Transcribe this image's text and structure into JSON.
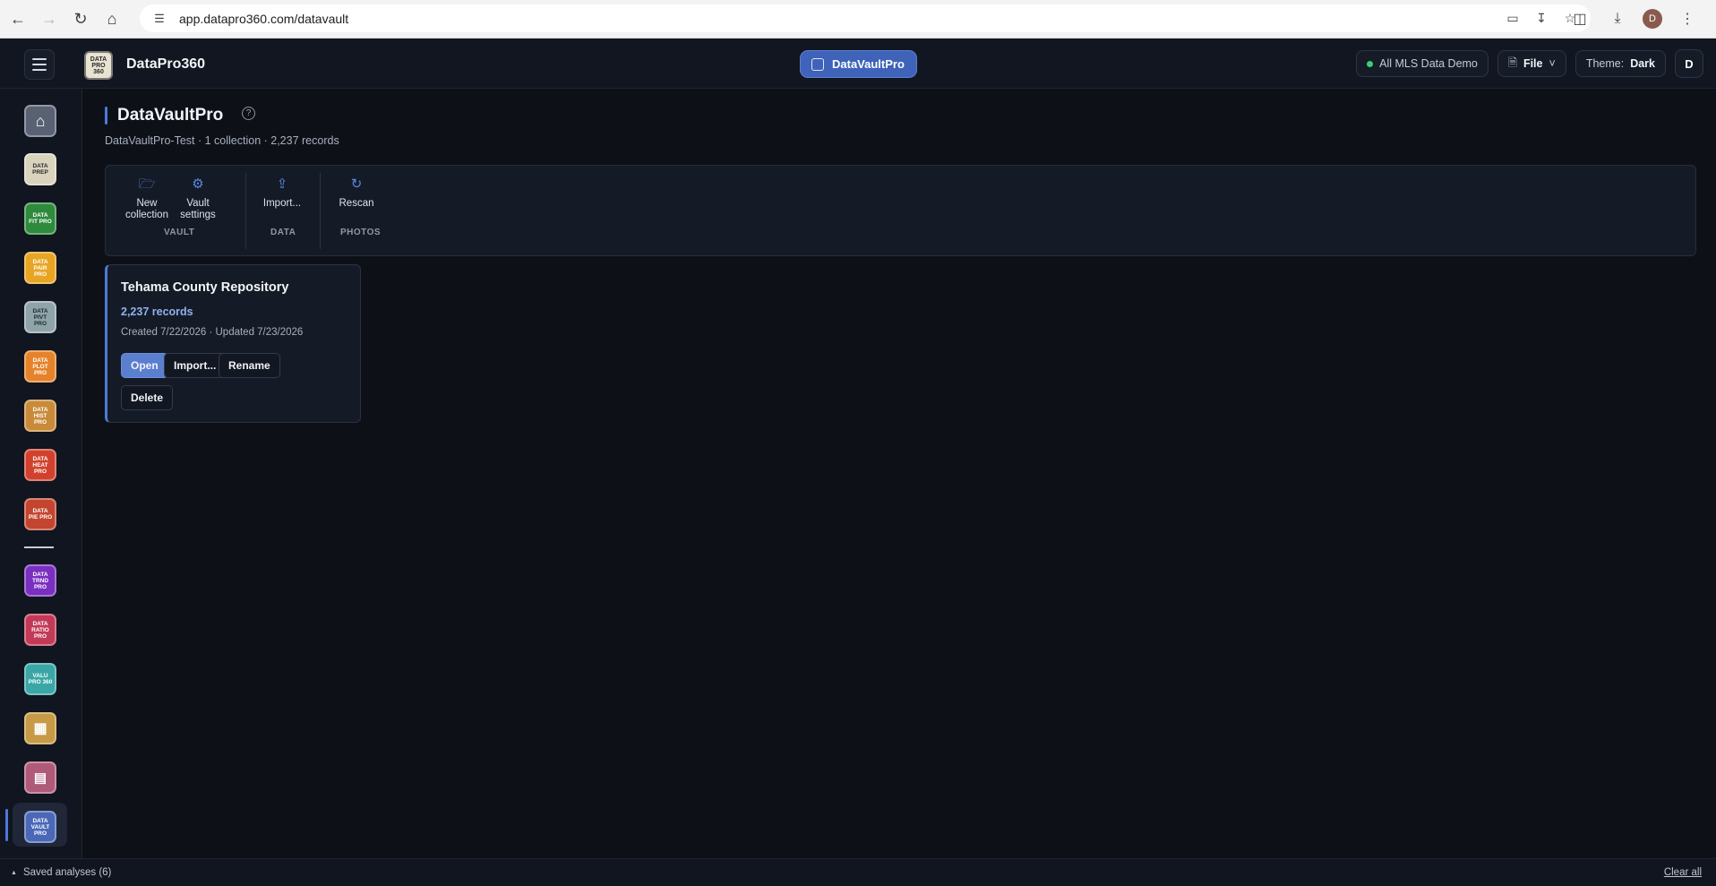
{
  "browser": {
    "url": "app.datapro360.com/datavault",
    "profile_initial": "D"
  },
  "header": {
    "brand_name": "DataPro360",
    "brand_logo_text": "DATA PRO 360",
    "active_app": "DataVaultPro",
    "dataset_label": "All MLS Data Demo",
    "file_label": "File",
    "theme_label": "Theme:",
    "theme_value": "Dark",
    "user_initial": "D",
    "status_color": "#3ccf6f",
    "accent_color": "#4f78da"
  },
  "sidebar": {
    "items": [
      {
        "name": "home-icon",
        "label": "",
        "bg": "#596272",
        "fg": "#ffffff"
      },
      {
        "name": "data-prep-pro",
        "label": "DATA PREP",
        "bg": "#d9d2bd",
        "fg": "#2a2a2a"
      },
      {
        "name": "data-fit-pro",
        "label": "DATA FIT PRO",
        "bg": "#2e8a3c",
        "fg": "#ffffff"
      },
      {
        "name": "data-pair-pro",
        "label": "DATA PAIR PRO",
        "bg": "#e8a524",
        "fg": "#ffffff"
      },
      {
        "name": "data-pivt-pro",
        "label": "DATA PIVT PRO",
        "bg": "#8fa4a8",
        "fg": "#1a2a2e"
      },
      {
        "name": "data-plot-pro",
        "label": "DATA PLOT PRO",
        "bg": "#e5832a",
        "fg": "#ffffff"
      },
      {
        "name": "data-hist-pro",
        "label": "DATA HIST PRO",
        "bg": "#c98a3a",
        "fg": "#ffffff"
      },
      {
        "name": "data-heat-pro",
        "label": "DATA HEAT PRO",
        "bg": "#d2412e",
        "fg": "#ffffff"
      },
      {
        "name": "data-pie-pro",
        "label": "DATA PIE PRO",
        "bg": "#c4452f",
        "fg": "#ffffff"
      },
      {
        "name": "data-trnd-pro",
        "label": "DATA TRND PRO",
        "bg": "#7a2fc0",
        "fg": "#ffffff"
      },
      {
        "name": "data-ratio-pro",
        "label": "DATA RATIO PRO",
        "bg": "#c23a57",
        "fg": "#ffffff"
      },
      {
        "name": "valu-pro-360",
        "label": "VALU PRO 360",
        "bg": "#3aa6a6",
        "fg": "#ffffff"
      },
      {
        "name": "table-app",
        "label": "",
        "bg": "#c79a45",
        "fg": "#ffffff"
      },
      {
        "name": "report-app",
        "label": "",
        "bg": "#b05a7a",
        "fg": "#ffffff"
      },
      {
        "name": "data-vault-pro",
        "label": "DATA VAULT PRO",
        "bg": "#4a67b8",
        "fg": "#ffffff"
      }
    ]
  },
  "main": {
    "title": "DataVaultPro",
    "subtitle": "DataVaultPro-Test · 1 collection · 2,237 records",
    "toolbar": {
      "new_collection": "New collection",
      "vault_settings": "Vault settings",
      "group_vault": "VAULT",
      "import": "Import...",
      "group_data": "DATA",
      "rescan": "Rescan",
      "group_photos": "PHOTOS"
    },
    "card": {
      "title": "Tehama County Repository",
      "records": "2,237 records",
      "dates": "Created 7/22/2026 · Updated 7/23/2026",
      "open": "Open",
      "import": "Import...",
      "rename": "Rename",
      "delete": "Delete"
    }
  },
  "footer": {
    "saved_analyses": "Saved analyses (6)",
    "clear_all": "Clear all"
  }
}
